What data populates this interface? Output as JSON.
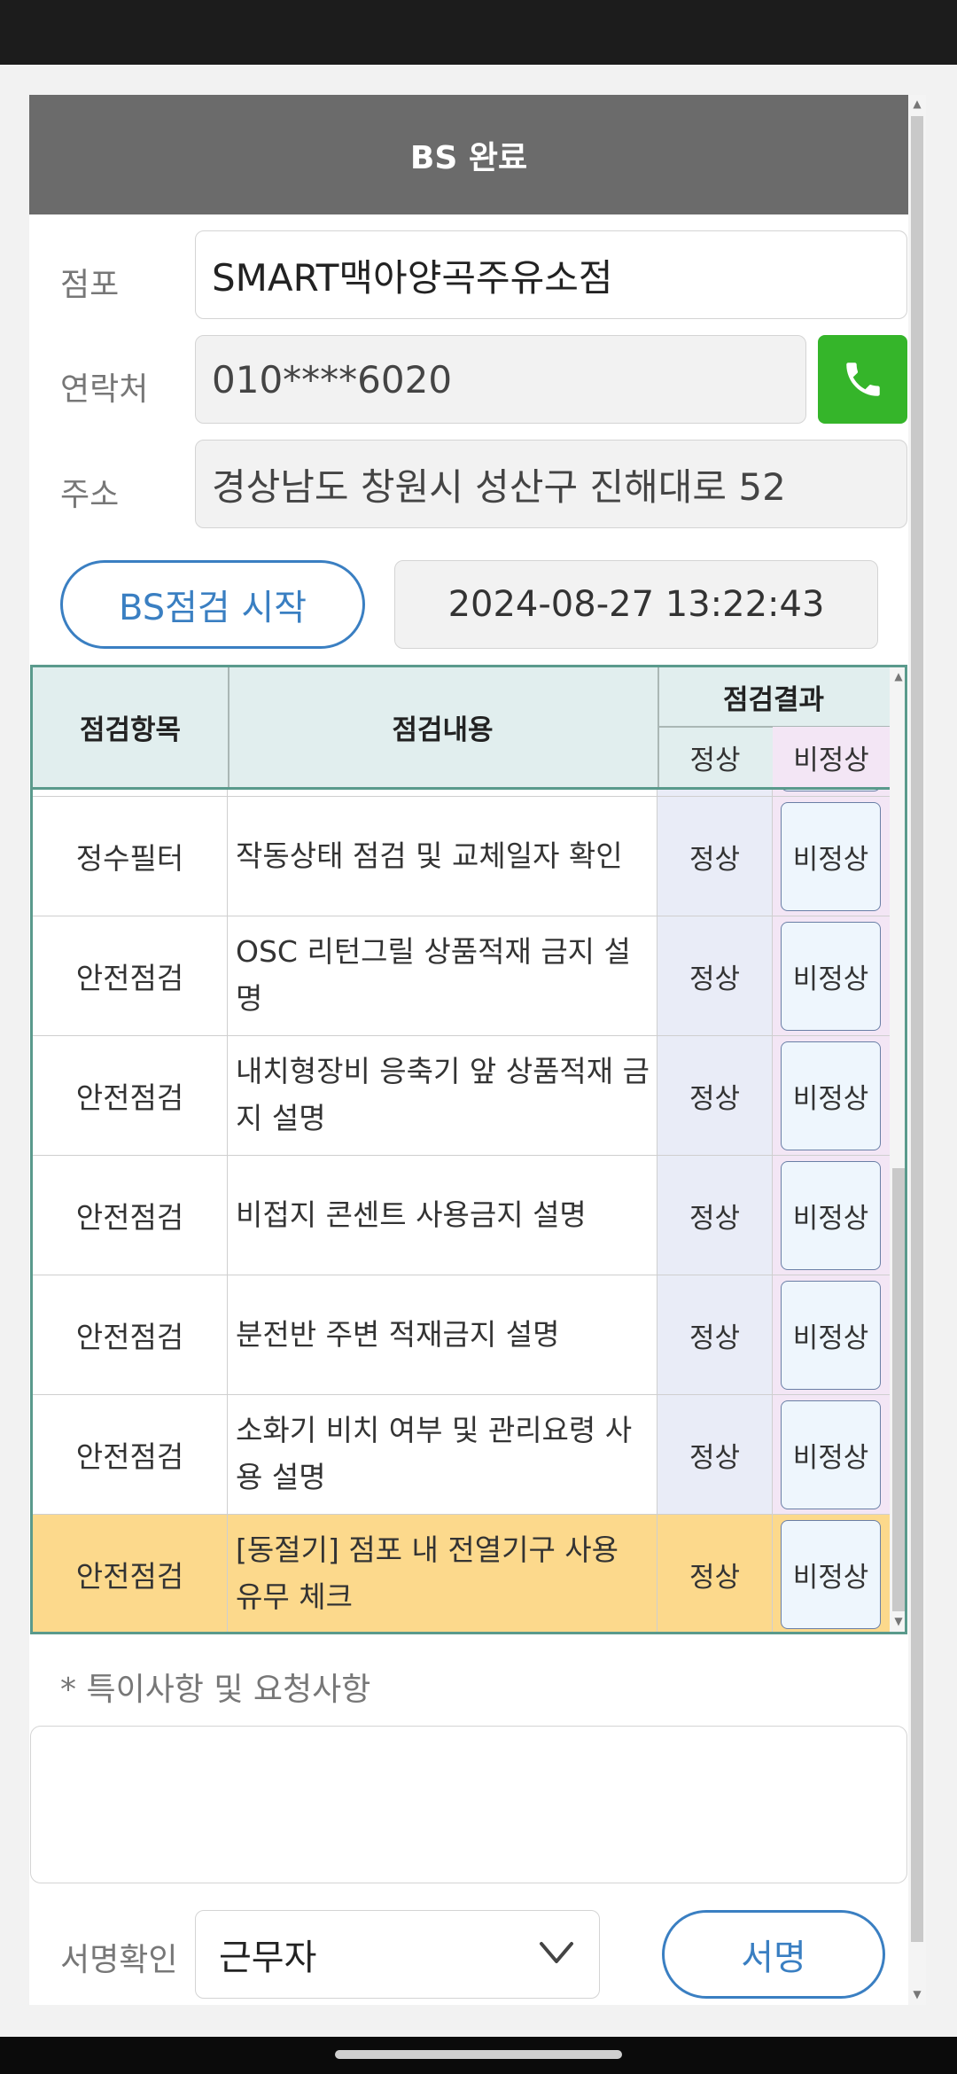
{
  "header": {
    "title": "BS 완료"
  },
  "form": {
    "store_label": "점포",
    "store_value": "SMART맥아양곡주유소점",
    "contact_label": "연락처",
    "contact_value": "010****6020",
    "address_label": "주소",
    "address_value": "경상남도 창원시 성산구 진해대로 52"
  },
  "inspection": {
    "start_label": "BS점검 시작",
    "datetime": "2024-08-27 13:22:43"
  },
  "table": {
    "headers": {
      "category": "점검항목",
      "content": "점검내용",
      "result": "점검결과",
      "normal": "정상",
      "abnormal": "비정상"
    },
    "rows": [
      {
        "category": "정수필터",
        "content": "작동상태 점검 및 교체일자 확인",
        "normal": "정상",
        "abnormal": "비정상"
      },
      {
        "category": "안전점검",
        "content": "OSC 리턴그릴 상품적재 금지 설명",
        "normal": "정상",
        "abnormal": "비정상"
      },
      {
        "category": "안전점검",
        "content": "내치형장비 응축기 앞 상품적재 금지 설명",
        "normal": "정상",
        "abnormal": "비정상"
      },
      {
        "category": "안전점검",
        "content": "비접지 콘센트 사용금지 설명",
        "normal": "정상",
        "abnormal": "비정상"
      },
      {
        "category": "안전점검",
        "content": "분전반 주변 적재금지 설명",
        "normal": "정상",
        "abnormal": "비정상"
      },
      {
        "category": "안전점검",
        "content": "소화기 비치 여부 및 관리요령 사용 설명",
        "normal": "정상",
        "abnormal": "비정상"
      },
      {
        "category": "안전점검",
        "content": "[동절기] 점포 내 전열기구 사용 유무 체크",
        "normal": "정상",
        "abnormal": "비정상",
        "highlighted": true
      }
    ]
  },
  "notes": {
    "label": "* 특이사항 및 요청사항",
    "value": ""
  },
  "signature": {
    "label": "서명확인",
    "selected": "근무자",
    "sign_button": "서명"
  },
  "colors": {
    "header_bg": "#6b6b6b",
    "accent_blue": "#3a7fc2",
    "call_green": "#35b52a",
    "table_border": "#5a9a8c",
    "highlight_row": "#fcd98c"
  }
}
